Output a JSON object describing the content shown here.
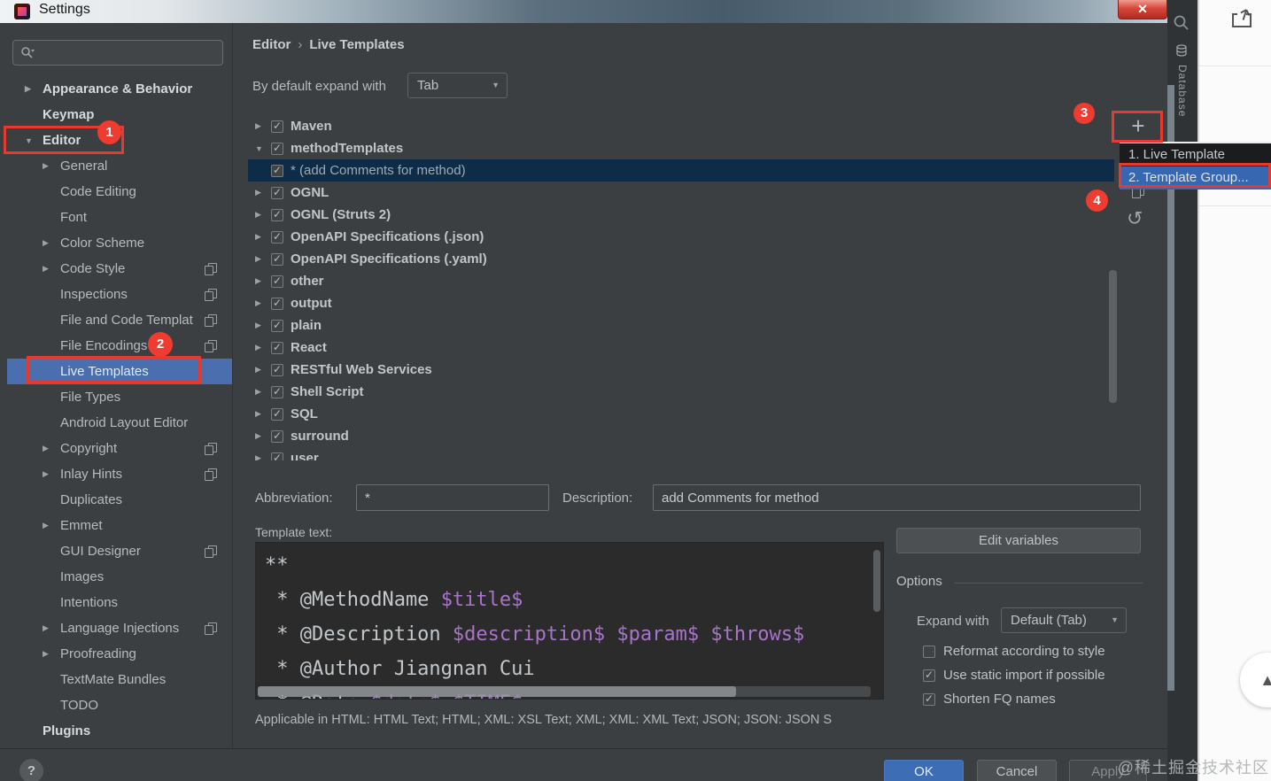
{
  "window": {
    "title": "Settings"
  },
  "glyphs": {
    "arrow_right": "▶",
    "arrow_down": "▼",
    "plus": "+",
    "undo": "↺",
    "help": "?",
    "scroll_top": "▲",
    "crumb_sep": "›",
    "close": "✕",
    "caret": "▼"
  },
  "colors": {
    "annotation_red": "#e8392f",
    "sidebar_selection": "#4b6eaf",
    "tree_selection": "#0e2c48",
    "popup_selection": "#3767b0",
    "ok_button": "#3d6db5",
    "template_variable": "#a874c9",
    "editor_background": "#2b2b2b"
  },
  "sidebar": {
    "items": [
      {
        "label": "Appearance & Behavior",
        "bold": true,
        "arrow": "right",
        "level": 0
      },
      {
        "label": "Keymap",
        "bold": true,
        "level": 0
      },
      {
        "label": "Editor",
        "bold": true,
        "arrow": "down",
        "level": 0
      },
      {
        "label": "General",
        "arrow": "right",
        "level": 1
      },
      {
        "label": "Code Editing",
        "level": 1
      },
      {
        "label": "Font",
        "level": 1
      },
      {
        "label": "Color Scheme",
        "arrow": "right",
        "level": 1
      },
      {
        "label": "Code Style",
        "arrow": "right",
        "level": 1,
        "copy": true
      },
      {
        "label": "Inspections",
        "level": 1,
        "copy": true
      },
      {
        "label": "File and Code Templat",
        "level": 1,
        "copy": true
      },
      {
        "label": "File Encodings",
        "level": 1,
        "copy": true
      },
      {
        "label": "Live Templates",
        "level": 1,
        "selected": true
      },
      {
        "label": "File Types",
        "level": 1
      },
      {
        "label": "Android Layout Editor",
        "level": 1
      },
      {
        "label": "Copyright",
        "arrow": "right",
        "level": 1,
        "copy": true
      },
      {
        "label": "Inlay Hints",
        "arrow": "right",
        "level": 1,
        "copy": true
      },
      {
        "label": "Duplicates",
        "level": 1
      },
      {
        "label": "Emmet",
        "arrow": "right",
        "level": 1
      },
      {
        "label": "GUI Designer",
        "level": 1,
        "copy": true
      },
      {
        "label": "Images",
        "level": 1
      },
      {
        "label": "Intentions",
        "level": 1
      },
      {
        "label": "Language Injections",
        "arrow": "right",
        "level": 1,
        "copy": true
      },
      {
        "label": "Proofreading",
        "arrow": "right",
        "level": 1
      },
      {
        "label": "TextMate Bundles",
        "level": 1
      },
      {
        "label": "TODO",
        "level": 1
      },
      {
        "label": "Plugins",
        "bold": true,
        "level": 0
      }
    ],
    "help_label": "?"
  },
  "breadcrumb": {
    "parts": [
      "Editor",
      "Live Templates"
    ]
  },
  "expand_row": {
    "label": "By default expand with",
    "value": "Tab"
  },
  "tree": {
    "rows": [
      {
        "label": "Maven",
        "arrow": "right",
        "checked": true
      },
      {
        "label": "methodTemplates",
        "arrow": "down",
        "checked": true
      },
      {
        "label": "* (add Comments for method)",
        "child": true,
        "checked": true,
        "selected": true
      },
      {
        "label": "OGNL",
        "arrow": "right",
        "checked": true
      },
      {
        "label": "OGNL (Struts 2)",
        "arrow": "right",
        "checked": true
      },
      {
        "label": "OpenAPI Specifications (.json)",
        "arrow": "right",
        "checked": true
      },
      {
        "label": "OpenAPI Specifications (.yaml)",
        "arrow": "right",
        "checked": true
      },
      {
        "label": "other",
        "arrow": "right",
        "checked": true
      },
      {
        "label": "output",
        "arrow": "right",
        "checked": true
      },
      {
        "label": "plain",
        "arrow": "right",
        "checked": true
      },
      {
        "label": "React",
        "arrow": "right",
        "checked": true
      },
      {
        "label": "RESTful Web Services",
        "arrow": "right",
        "checked": true
      },
      {
        "label": "Shell Script",
        "arrow": "right",
        "checked": true
      },
      {
        "label": "SQL",
        "arrow": "right",
        "checked": true
      },
      {
        "label": "surround",
        "arrow": "right",
        "checked": true
      },
      {
        "label": "user",
        "arrow": "right",
        "checked": true
      }
    ]
  },
  "popup": {
    "items": [
      {
        "label": "1. Live Template",
        "selected": false
      },
      {
        "label": "2. Template Group...",
        "selected": true
      }
    ]
  },
  "form": {
    "abbreviation_label": "Abbreviation:",
    "abbreviation_value": "*",
    "description_label": "Description:",
    "description_value": "add Comments for method",
    "template_text_label": "Template text:",
    "code_lines": [
      {
        "tokens": [
          {
            "t": "**",
            "k": "p"
          }
        ]
      },
      {
        "tokens": [
          {
            "t": " * @MethodName ",
            "k": "p"
          },
          {
            "t": "$title$",
            "k": "v"
          }
        ]
      },
      {
        "tokens": [
          {
            "t": " * @Description ",
            "k": "p"
          },
          {
            "t": "$description$",
            "k": "v"
          },
          {
            "t": " ",
            "k": "p"
          },
          {
            "t": "$param$",
            "k": "v"
          },
          {
            "t": " ",
            "k": "p"
          },
          {
            "t": "$throws$",
            "k": "v"
          }
        ]
      },
      {
        "tokens": [
          {
            "t": " * @Author Jiangnan Cui",
            "k": "p"
          }
        ]
      },
      {
        "tokens": [
          {
            "t": " * @Date ",
            "k": "p"
          },
          {
            "t": "$date$",
            "k": "v"
          },
          {
            "t": " ",
            "k": "p"
          },
          {
            "t": "$TIME$",
            "k": "v"
          }
        ]
      }
    ],
    "edit_variables_label": "Edit variables",
    "options_title": "Options",
    "expand_with_label": "Expand with",
    "expand_with_value": "Default (Tab)",
    "checkboxes": [
      {
        "label": "Reformat according to style",
        "checked": false
      },
      {
        "label": "Use static import if possible",
        "checked": true
      },
      {
        "label": "Shorten FQ names",
        "checked": true
      }
    ],
    "applicable_text": "Applicable in HTML: HTML Text; HTML; XML: XSL Text; XML; XML: XML Text; JSON; JSON: JSON S"
  },
  "footer": {
    "ok": "OK",
    "cancel": "Cancel",
    "apply": "Apply"
  },
  "annotations": {
    "n1": "1",
    "n2": "2",
    "n3": "3",
    "n4": "4"
  },
  "right_panel": {
    "database_label": "Database"
  },
  "watermark": "@稀土掘金技术社区"
}
